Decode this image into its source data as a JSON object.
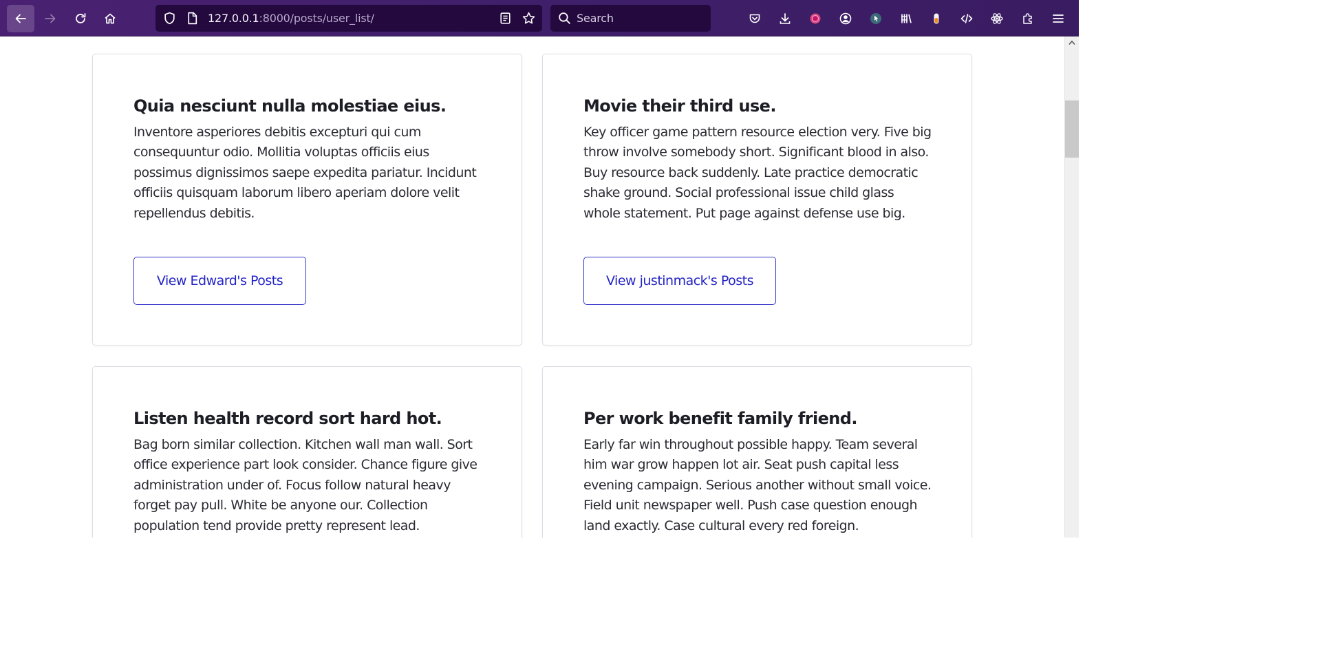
{
  "browser": {
    "url_host": "127.0.0.1",
    "url_path": ":8000/posts/user_list/",
    "search_placeholder": "Search",
    "toolbar_icons": [
      "back-icon",
      "forward-icon",
      "reload-icon",
      "home-icon",
      "shield-icon",
      "page-icon",
      "reader-view-icon",
      "bookmark-star-icon",
      "search-icon",
      "pocket-icon",
      "download-icon",
      "extension-circle-icon",
      "account-icon",
      "extension-cursor-icon",
      "library-icon",
      "extension-toggle-icon",
      "dev-tools-icon",
      "react-icon",
      "extensions-icon",
      "menu-icon"
    ]
  },
  "cards": [
    {
      "title": "Quia nesciunt nulla molestiae eius.",
      "body": "Inventore asperiores debitis excepturi qui cum consequuntur odio. Mollitia voluptas officiis eius possimus dignissimos saepe expedita pariatur. Incidunt officiis quisquam laborum libero aperiam dolore velit repellendus debitis.",
      "button": "View Edward's Posts"
    },
    {
      "title": "Movie their third use.",
      "body": "Key officer game pattern resource election very. Five big throw involve somebody short. Significant blood in also. Buy resource back suddenly. Late practice democratic shake ground. Social professional issue child glass whole statement. Put page against defense use big.",
      "button": "View justinmack's Posts"
    },
    {
      "title": "Listen health record sort hard hot.",
      "body": "Bag born similar collection. Kitchen wall man wall. Sort office experience part look consider. Chance figure give administration under of. Focus follow natural heavy forget pay pull. White be anyone our. Collection population tend provide pretty represent lead."
    },
    {
      "title": "Per work benefit family friend.",
      "body": "Early far win throughout possible happy. Team several him war grow happen lot air. Seat push capital less evening campaign. Serious another without small voice. Field unit newspaper well. Push case question enough land exactly. Case cultural every red foreign."
    }
  ],
  "colors": {
    "toolbar": "#4a2172",
    "urlbar": "#24093f",
    "link": "#2222c6",
    "card_border": "#dedde6"
  }
}
